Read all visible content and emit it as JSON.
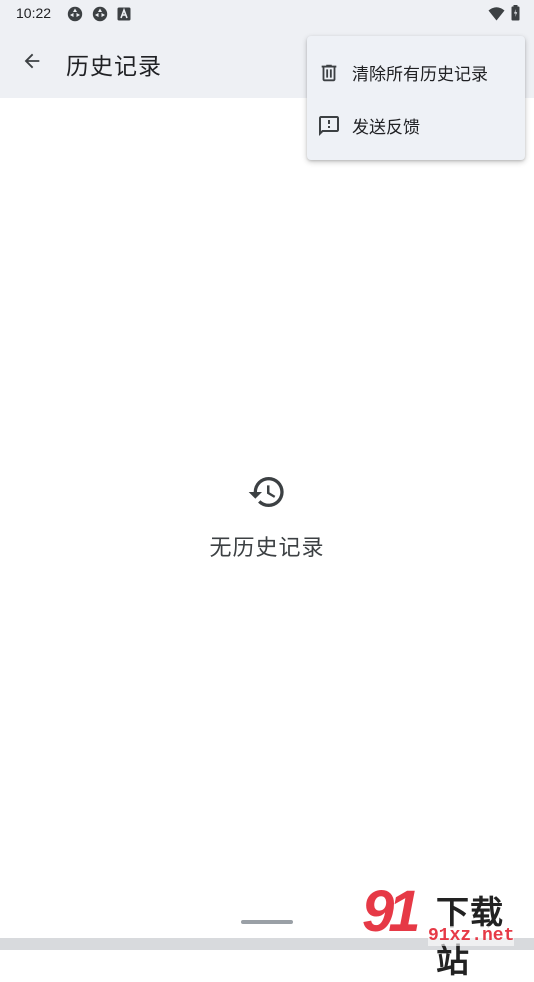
{
  "status_bar": {
    "time": "10:22",
    "left_icons": [
      "sync-icon",
      "sync-icon",
      "font-a-icon"
    ],
    "right_icons": [
      "wifi-icon",
      "battery-icon"
    ]
  },
  "app_bar": {
    "title": "历史记录",
    "back_icon": "arrow-back-icon"
  },
  "overflow_menu": {
    "items": [
      {
        "label": "清除所有历史记录",
        "icon": "trash-icon"
      },
      {
        "label": "发送反馈",
        "icon": "feedback-icon"
      }
    ]
  },
  "empty_state": {
    "icon": "history-icon",
    "text": "无历史记录"
  },
  "watermark": {
    "logo_number": "91",
    "brand": "下载站",
    "url": "91xz.net",
    "color": "#e63946"
  },
  "colors": {
    "bar_background": "#eef0f4",
    "menu_background": "#eef1f6",
    "text_primary": "#202124"
  }
}
